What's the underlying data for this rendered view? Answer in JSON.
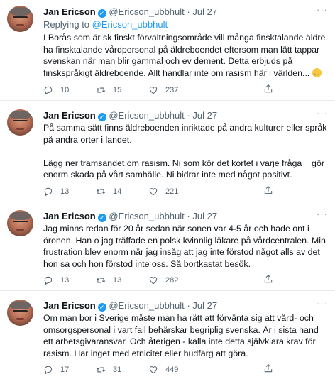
{
  "tweets": [
    {
      "name": "Jan Ericson",
      "handle": "@Ericson_ubbhult",
      "separator": "·",
      "date": "Jul 27",
      "replying_prefix": "Replying to ",
      "replying_to": "@Ericson_ubbhult",
      "text": "I Borås som är sk finskt förvaltningsområde vill många finsktalande äldre ha finsktalande vårdpersonal på äldreboendet eftersom man lätt tappar svenskan när man blir gammal och ev dement. Detta erbjuds på finskspråkigt äldreboende. Allt handlar inte om rasism här i världen...",
      "emoji": "smirk-face",
      "replies": "10",
      "retweets": "15",
      "likes": "237"
    },
    {
      "name": "Jan Ericson",
      "handle": "@Ericson_ubbhult",
      "separator": "·",
      "date": "Jul 27",
      "text": "På samma sätt finns äldreboenden inriktade på andra kulturer eller språk på andra orter i landet.\n\nLägg ner tramsandet om rasism. Ni som kör det kortet i varje fråga    gör enorm skada på vårt samhälle. Ni bidrar inte med något positivt.",
      "replies": "13",
      "retweets": "14",
      "likes": "221"
    },
    {
      "name": "Jan Ericson",
      "handle": "@Ericson_ubbhult",
      "separator": "·",
      "date": "Jul 27",
      "text": "Jag minns redan för 20 år sedan när sonen var 4-5 år och hade ont i öronen. Han o jag träffade en polsk kvinnlig läkare på vårdcentralen. Min frustration blev enorm när jag insåg att jag inte förstod något alls av det hon sa och hon förstod inte oss. Så bortkastat besök.",
      "replies": "13",
      "retweets": "13",
      "likes": "282"
    },
    {
      "name": "Jan Ericson",
      "handle": "@Ericson_ubbhult",
      "separator": "·",
      "date": "Jul 27",
      "text": "Om man bor i Sverige måste man ha rätt att förvänta sig att vård- och omsorgspersonal i vart fall behärskar begriplig svenska. Är i sista hand ett arbetsgivaransvar. Och återigen - kalla inte detta självklara krav för rasism. Har inget med etnicitet eller hudfärg att göra.",
      "replies": "17",
      "retweets": "31",
      "likes": "449"
    }
  ]
}
